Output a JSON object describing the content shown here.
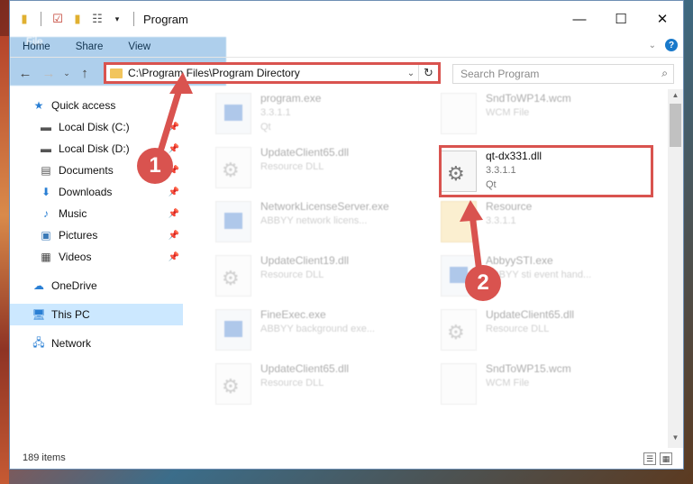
{
  "window": {
    "title": "Program",
    "controls": {
      "minimize": "—",
      "maximize": "☐",
      "close": "✕"
    }
  },
  "ribbon": {
    "tabs": [
      "File",
      "Home",
      "Share",
      "View"
    ]
  },
  "nav": {
    "address_path": "C:\\Program Files\\Program Directory",
    "search_placeholder": "Search Program"
  },
  "sidebar": {
    "items": [
      {
        "label": "Quick access",
        "icon": "star-icon"
      },
      {
        "label": "Local Disk (C:)",
        "icon": "drive-icon"
      },
      {
        "label": "Local Disk (D:)",
        "icon": "drive-icon"
      },
      {
        "label": "Documents",
        "icon": "documents-icon"
      },
      {
        "label": "Downloads",
        "icon": "downloads-icon"
      },
      {
        "label": "Music",
        "icon": "music-icon"
      },
      {
        "label": "Pictures",
        "icon": "pictures-icon"
      },
      {
        "label": "Videos",
        "icon": "videos-icon"
      },
      {
        "label": "OneDrive",
        "icon": "cloud-icon"
      },
      {
        "label": "This PC",
        "icon": "computer-icon"
      },
      {
        "label": "Network",
        "icon": "network-icon"
      }
    ]
  },
  "files": [
    {
      "name": "program.exe",
      "line2": "3.3.1.1",
      "line3": "Qt",
      "icon": "exe-icon"
    },
    {
      "name": "SndToWP14.wcm",
      "line2": "WCM File",
      "line3": "",
      "icon": "file-icon"
    },
    {
      "name": "UpdateClient65.dll",
      "line2": "Resource DLL",
      "line3": "",
      "icon": "dll-icon"
    },
    {
      "name": "qt-dx331.dll",
      "line2": "3.3.1.1",
      "line3": "Qt",
      "icon": "dll-icon"
    },
    {
      "name": "NetworkLicenseServer.exe",
      "line2": "ABBYY network licens...",
      "line3": "",
      "icon": "exe-icon"
    },
    {
      "name": "Resource",
      "line2": "3.3.1.1",
      "line3": "",
      "icon": "folder-icon"
    },
    {
      "name": "UpdateClient19.dll",
      "line2": "Resource DLL",
      "line3": "",
      "icon": "dll-icon"
    },
    {
      "name": "AbbyySTI.exe",
      "line2": "ABBYY sti event hand...",
      "line3": "",
      "icon": "exe-icon"
    },
    {
      "name": "FineExec.exe",
      "line2": "ABBYY background exe...",
      "line3": "",
      "icon": "exe-icon"
    },
    {
      "name": "UpdateClient65.dll",
      "line2": "Resource DLL",
      "line3": "",
      "icon": "dll-icon"
    },
    {
      "name": "UpdateClient65.dll",
      "line2": "Resource DLL",
      "line3": "",
      "icon": "dll-icon"
    },
    {
      "name": "SndToWP15.wcm",
      "line2": "WCM File",
      "line3": "",
      "icon": "file-icon"
    }
  ],
  "status": {
    "item_count": "189 items"
  },
  "callouts": [
    "1",
    "2"
  ],
  "colors": {
    "accent": "#1979ca",
    "annotation": "#d9534f",
    "selection": "#cce8ff"
  }
}
